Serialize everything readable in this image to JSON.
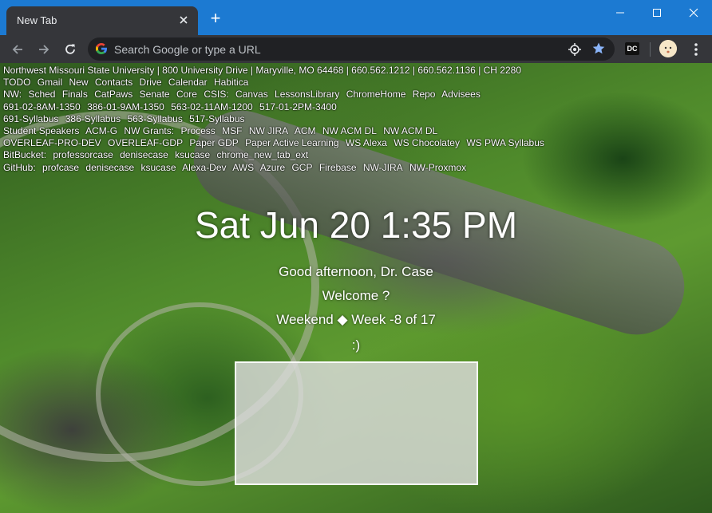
{
  "tab": {
    "title": "New Tab"
  },
  "omnibox": {
    "placeholder": "Search Google or type a URL"
  },
  "extension": {
    "label": "DC"
  },
  "links": {
    "header": "Northwest Missouri State University | 800 University Drive | Maryville, MO 64468 | 660.562.1212 | 660.562.1136 | CH 2280",
    "rows": [
      [
        "TODO",
        "Gmail",
        "New",
        "Contacts",
        "Drive",
        "Calendar",
        "Habitica"
      ],
      [
        "NW:",
        "Sched",
        "Finals",
        "CatPaws",
        "Senate",
        "Core",
        "CSIS:",
        "Canvas",
        "LessonsLibrary",
        "ChromeHome",
        "Repo",
        "Advisees"
      ],
      [
        "691-02-8AM-1350",
        "386-01-9AM-1350",
        "563-02-11AM-1200",
        "517-01-2PM-3400"
      ],
      [
        "691-Syllabus",
        "386-Syllabus",
        "563-Syllabus",
        "517-Syllabus"
      ],
      [
        "Student Speakers",
        "ACM-G",
        "NW Grants:",
        "Process",
        "MSF",
        "NW JIRA",
        "ACM",
        "NW ACM DL",
        "NW ACM DL"
      ],
      [
        "OVERLEAF-PRO-DEV",
        "OVERLEAF-GDP",
        "Paper GDP",
        "Paper Active Learning",
        "WS Alexa",
        "WS Chocolatey",
        "WS PWA Syllabus"
      ],
      [
        "BitBucket:",
        "professorcase",
        "denisecase",
        "ksucase",
        "chrome_new_tab_ext"
      ],
      [
        "GitHub:",
        "profcase",
        "denisecase",
        "ksucase",
        "Alexa-Dev",
        "AWS",
        "Azure",
        "GCP",
        "Firebase",
        "NW-JIRA",
        "NW-Proxmox"
      ]
    ]
  },
  "clock": {
    "text": "Sat Jun 20 1:35 PM"
  },
  "messages": {
    "greeting": "Good afternoon, Dr. Case",
    "welcome": "Welcome ?",
    "week": "Weekend ◆ Week -8 of 17",
    "smile": ":)"
  },
  "colors": {
    "titlebar": "#1c7ad2",
    "toolbar": "#35363a",
    "omnibox": "#202124",
    "star": "#8ab4f8"
  }
}
